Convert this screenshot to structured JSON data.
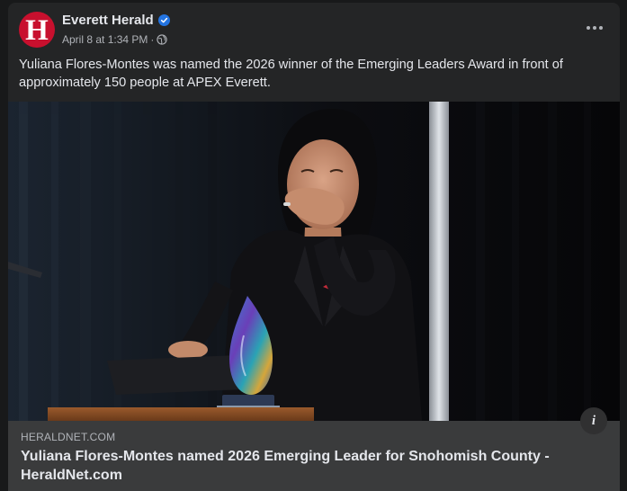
{
  "post": {
    "page_name": "Everett Herald",
    "avatar_letter": "H",
    "verified_icon": "verified-badge-icon",
    "timestamp": "April 8 at 1:34 PM",
    "separator": "·",
    "audience_icon": "globe-icon",
    "more_icon": "more-options-icon",
    "caption": "Yuliana Flores-Montes was named the 2026 winner of the Emerging Leaders Award in front of approximately 150 people at APEX Everett."
  },
  "link_preview": {
    "domain": "HERALDNET.COM",
    "title": "Yuliana Flores-Montes named 2026 Emerging Leader for Snohomish County - HeraldNet.com",
    "info_label": "i"
  },
  "colors": {
    "background": "#18191a",
    "card": "#242526",
    "link_box": "#3a3b3c",
    "brand_red": "#c8102e",
    "verified_blue": "#2374e1",
    "primary_text": "#e4e6eb",
    "secondary_text": "#b0b3b8"
  }
}
